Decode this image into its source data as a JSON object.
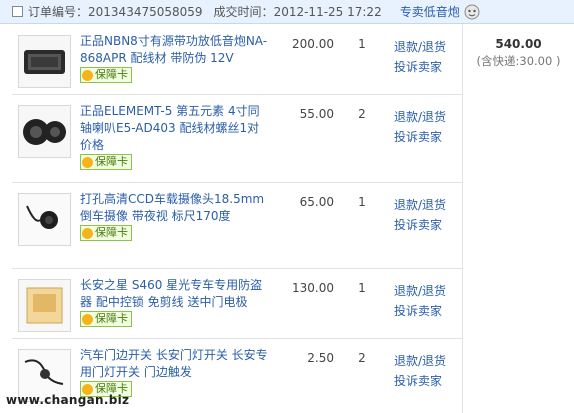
{
  "order": {
    "number_label": "订单编号：",
    "number": "201343475058059",
    "time_label": "成交时间：",
    "time": "2012-11-25 17:22",
    "shop": "专卖低音炮"
  },
  "items": [
    {
      "title": "正品NBN8寸有源带功放低音炮NA-868APR 配线材 带防伪 12V",
      "badge": "保障卡",
      "price": "200.00",
      "qty": "1",
      "refund": "退款/退货",
      "complain": "投诉卖家"
    },
    {
      "title": "正品ELEMEMT-5 第五元素 4寸同轴喇叭E5-AD403 配线材螺丝1对价格",
      "badge": "保障卡",
      "price": "55.00",
      "qty": "2",
      "refund": "退款/退货",
      "complain": "投诉卖家"
    },
    {
      "title": "打孔高清CCD车载摄像头18.5mm 倒车摄像 带夜视 标尺170度",
      "badge": "保障卡",
      "price": "65.00",
      "qty": "1",
      "refund": "退款/退货",
      "complain": "投诉卖家"
    },
    {
      "title": "长安之星 S460 星光专车专用防盗器 配中控锁 免剪线 送中门电极",
      "badge": "保障卡",
      "price": "130.00",
      "qty": "1",
      "refund": "退款/退货",
      "complain": "投诉卖家"
    },
    {
      "title": "汽车门边开关 长安门灯开关 长安专用门灯开关 门边触发",
      "badge": "保障卡",
      "price": "2.50",
      "qty": "2",
      "refund": "退款/退货",
      "complain": "投诉卖家"
    }
  ],
  "summary": {
    "total": "540.00",
    "shipping": "(含快递:30.00 )"
  },
  "watermark": "www.changan.biz"
}
